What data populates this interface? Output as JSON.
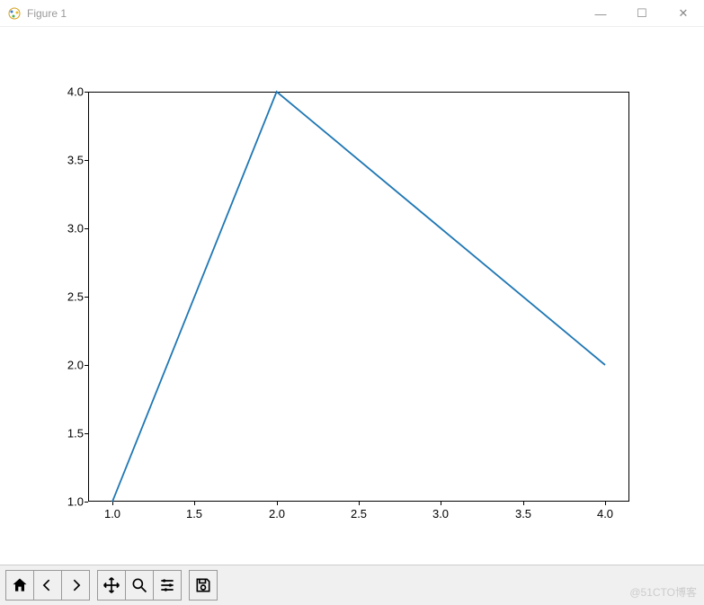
{
  "window": {
    "title": "Figure 1",
    "controls": {
      "minimize": "—",
      "maximize": "☐",
      "close": "✕"
    }
  },
  "chart_data": {
    "type": "line",
    "x": [
      1.0,
      2.0,
      3.0,
      4.0
    ],
    "y": [
      1.0,
      4.0,
      3.0,
      2.0
    ],
    "xlim": [
      1.0,
      4.0
    ],
    "ylim": [
      1.0,
      4.0
    ],
    "x_ticks": [
      "1.0",
      "1.5",
      "2.0",
      "2.5",
      "3.0",
      "3.5",
      "4.0"
    ],
    "y_ticks": [
      "1.0",
      "1.5",
      "2.0",
      "2.5",
      "3.0",
      "3.5",
      "4.0"
    ],
    "line_color": "#1f77b4"
  },
  "toolbar": {
    "home": "home-icon",
    "back": "back-icon",
    "forward": "forward-icon",
    "pan": "pan-icon",
    "zoom": "zoom-icon",
    "configure": "configure-icon",
    "save": "save-icon"
  },
  "watermark": "@51CTO博客"
}
